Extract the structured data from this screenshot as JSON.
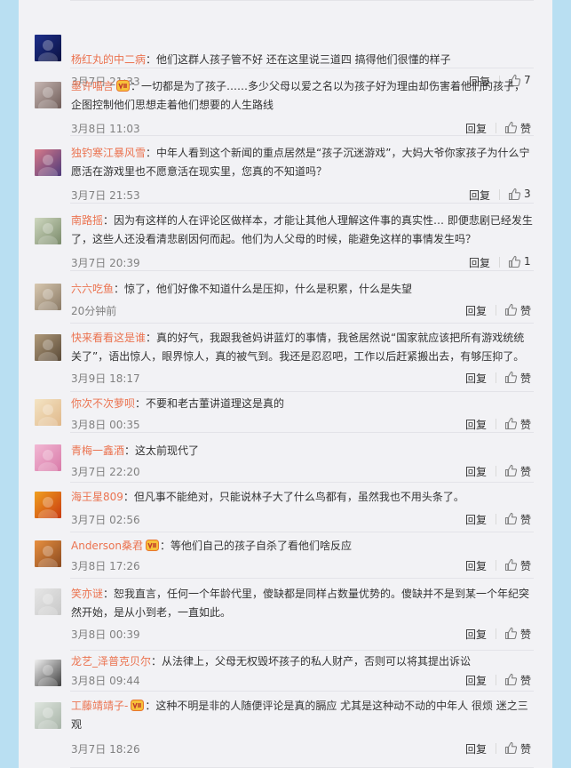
{
  "page": {
    "reply_label": "回复"
  },
  "comments": [
    {
      "user": "",
      "vip": false,
      "text": "",
      "time": "3月7日 12:51",
      "likes": "7",
      "avatar": {
        "c1": "#8a6a55",
        "c2": "#6a7e8a"
      }
    },
    {
      "user": "杨红丸的中二病",
      "vip": false,
      "text": "他们这群人孩子管不好 还在这里说三道四 搞得他们很懂的样子",
      "time": "3月7日 21:33",
      "likes": "7",
      "avatar": {
        "c1": "#1e2f8a",
        "c2": "#0b1242"
      }
    },
    {
      "user": "墨许喵言",
      "vip": true,
      "text": "一切都是为了孩子……多少父母以爱之名以为孩子好为理由却伤害着他们的孩子，企图控制他们思想走着他们想要的人生路线",
      "time": "3月8日 11:03",
      "likes": "赞",
      "avatar": {
        "c1": "#c8b8b4",
        "c2": "#6e5c58"
      }
    },
    {
      "user": "独钓寒江暴风雪",
      "vip": false,
      "text": "中年人看到这个新闻的重点居然是“孩子沉迷游戏”，大妈大爷你家孩子为什么宁愿活在游戏里也不愿意活在现实里，您真的不知道吗？",
      "time": "3月7日 21:53",
      "likes": "3",
      "avatar": {
        "c1": "#d87a8a",
        "c2": "#4e3a7a"
      }
    },
    {
      "user": "南路摇",
      "vip": false,
      "text": "因为有这样的人在评论区做样本，才能让其他人理解这件事的真实性… 即便悲剧已经发生了，这些人还没看清悲剧因何而起。他们为人父母的时候，能避免这样的事情发生吗？",
      "time": "3月7日 20:39",
      "likes": "1",
      "avatar": {
        "c1": "#cfd8c0",
        "c2": "#7a8a6a"
      }
    },
    {
      "user": "六六吃鱼",
      "vip": false,
      "text": "惊了，他们好像不知道什么是压抑，什么是积累，什么是失望",
      "time": "20分钟前",
      "likes": "赞",
      "avatar": {
        "c1": "#d8c8b0",
        "c2": "#8a7a66"
      }
    },
    {
      "user": "快来看看这是谁",
      "vip": false,
      "text": "真的好气，我跟我爸妈讲蓝灯的事情，我爸居然说“国家就应该把所有游戏统统关了”，语出惊人，眼界惊人，真的被气到。我还是忍忍吧，工作以后赶紧搬出去，有够压抑了。",
      "time": "3月9日 18:17",
      "likes": "赞",
      "avatar": {
        "c1": "#b09a7a",
        "c2": "#5a4a38"
      }
    },
    {
      "user": "你次不次萝呗",
      "vip": false,
      "text": "不要和老古董讲道理这是真的",
      "time": "3月8日 00:35",
      "likes": "赞",
      "avatar": {
        "c1": "#f4e4c4",
        "c2": "#e0b88a"
      }
    },
    {
      "user": "青梅一鑫酒",
      "vip": false,
      "text": "这太前现代了",
      "time": "3月7日 22:20",
      "likes": "赞",
      "avatar": {
        "c1": "#f2b8d4",
        "c2": "#d87aa8"
      }
    },
    {
      "user": "海王星809",
      "vip": false,
      "text": "但凡事不能绝对，只能说林子大了什么鸟都有，虽然我也不用头条了。",
      "time": "3月7日 02:56",
      "likes": "赞",
      "avatar": {
        "c1": "#f0a020",
        "c2": "#c83a10"
      }
    },
    {
      "user": "Anderson桑君",
      "vip": true,
      "text": "等他们自己的孩子自杀了看他们啥反应",
      "time": "3月8日 17:26",
      "likes": "赞",
      "avatar": {
        "c1": "#e89040",
        "c2": "#8a4a20"
      }
    },
    {
      "user": "笑亦谜",
      "vip": false,
      "text": "恕我直言，任何一个年龄代里，傻缺都是同样占数量优势的。傻缺并不是到某一个年纪突然开始，是从小到老，一直如此。",
      "time": "3月8日 00:39",
      "likes": "赞",
      "avatar": {
        "c1": "#e6e6e6",
        "c2": "#c8c8c8"
      }
    },
    {
      "user": "龙艺_泽普克贝尔",
      "vip": false,
      "text": "从法律上，父母无权毁坏孩子的私人财产，否则可以将其提出诉讼",
      "time": "3月8日 09:44",
      "likes": "赞",
      "avatar": {
        "c1": "#f0f0f0",
        "c2": "#404040"
      }
    },
    {
      "user": "工藤靖靖子-",
      "vip": true,
      "text": "这种不明是非的人随便评论是真的膈应 尤其是这种动不动的中年人 很烦 迷之三观",
      "time": "3月7日 18:26",
      "likes": "赞",
      "avatar": {
        "c1": "#dfe6df",
        "c2": "#a8b4a8"
      }
    }
  ]
}
